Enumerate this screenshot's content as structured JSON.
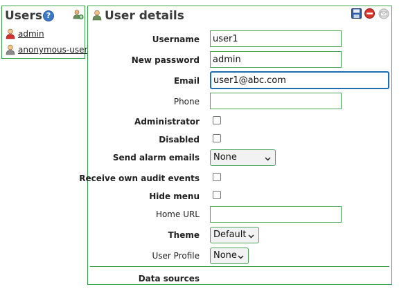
{
  "users_panel": {
    "title": "Users",
    "help_glyph": "?",
    "items": [
      {
        "name": "admin",
        "icon": "admin-user-icon"
      },
      {
        "name": "anonymous-user",
        "icon": "user-icon"
      }
    ]
  },
  "details": {
    "title": "User details",
    "toolbar": [
      "save-icon",
      "delete-icon",
      "email-icon"
    ],
    "fields": {
      "username": {
        "label": "Username",
        "value": "user1"
      },
      "new_password": {
        "label": "New password",
        "value": "admin"
      },
      "email": {
        "label": "Email",
        "value": "user1@abc.com"
      },
      "phone": {
        "label": "Phone",
        "value": ""
      },
      "administrator": {
        "label": "Administrator",
        "checked": false
      },
      "disabled": {
        "label": "Disabled",
        "checked": false
      },
      "send_alarm_emails": {
        "label": "Send alarm emails",
        "value": "None"
      },
      "receive_audit": {
        "label": "Receive own audit events",
        "checked": false
      },
      "hide_menu": {
        "label": "Hide menu",
        "checked": false
      },
      "home_url": {
        "label": "Home URL",
        "value": ""
      },
      "theme": {
        "label": "Theme",
        "value": "Default"
      },
      "user_profile": {
        "label": "User Profile",
        "value": "None"
      }
    },
    "data_sources_label": "Data sources"
  },
  "colors": {
    "border": "#36a34a",
    "focus": "#1a6fb0",
    "help": "#3c78c8",
    "delete": "#d9342b"
  }
}
